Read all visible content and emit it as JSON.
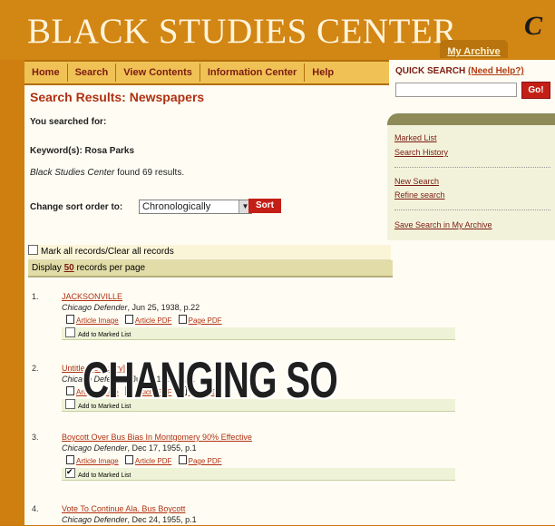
{
  "site": {
    "title": "BLACK STUDIES CENTER",
    "archive_tab": "My Archive",
    "logo_letter": "C"
  },
  "nav": {
    "items": [
      "Home",
      "Search",
      "View Contents",
      "Information Center",
      "Help"
    ]
  },
  "quick_search": {
    "label": "QUICK SEARCH",
    "help": "(Need Help?)",
    "input_value": "",
    "go_label": "Go!"
  },
  "results": {
    "heading": "Search Results: Newspapers",
    "searched_for": "You searched for:",
    "keyword_line": "Keyword(s): Rosa Parks",
    "found_line_prefix": "Black Studies Center",
    "found_line_rest": " found 69 results.",
    "sort_label": "Change sort order to:",
    "sort_value": "Chronologically",
    "sort_button": "Sort",
    "mark_all": "Mark all records/Clear all records",
    "display_prefix": "Display ",
    "per_page": "50",
    "display_suffix": " records per page",
    "items": [
      {
        "num": "1.",
        "title": "JACKSONVILLE",
        "source": "Chicago Defender",
        "date": ", Jun 25, 1938, p.22",
        "links": [
          "Article Image",
          "Article PDF",
          "Page PDF"
        ],
        "add": "Add to Marked List",
        "checked": false
      },
      {
        "num": "2.",
        "title": "Untitled [obituary]",
        "source": "Chicago Defender",
        "date": ", Jun ... 1954, p. ...",
        "links": [
          "Article Image",
          "Article PDF",
          "Page PDF"
        ],
        "add": "Add to Marked List",
        "checked": false
      },
      {
        "num": "3.",
        "title": "Boycott Over Bus Bias In Montgomery 90% Effective",
        "source": "Chicago Defender",
        "date": ", Dec 17, 1955, p.1",
        "links": [
          "Article Image",
          "Article PDF",
          "Page PDF"
        ],
        "add": "Add to Marked List",
        "checked": true
      },
      {
        "num": "4.",
        "title": "Vote To Continue Ala. Bus Boycott",
        "source": "Chicago Defender",
        "date": ", Dec 24, 1955, p.1"
      }
    ]
  },
  "sidebar": {
    "marked_list": "Marked List",
    "search_history": "Search History",
    "new_search": "New Search",
    "refine_search": "Refine search",
    "save_search": "Save Search in My Archive"
  },
  "overlay_text": "CHANGING SO"
}
